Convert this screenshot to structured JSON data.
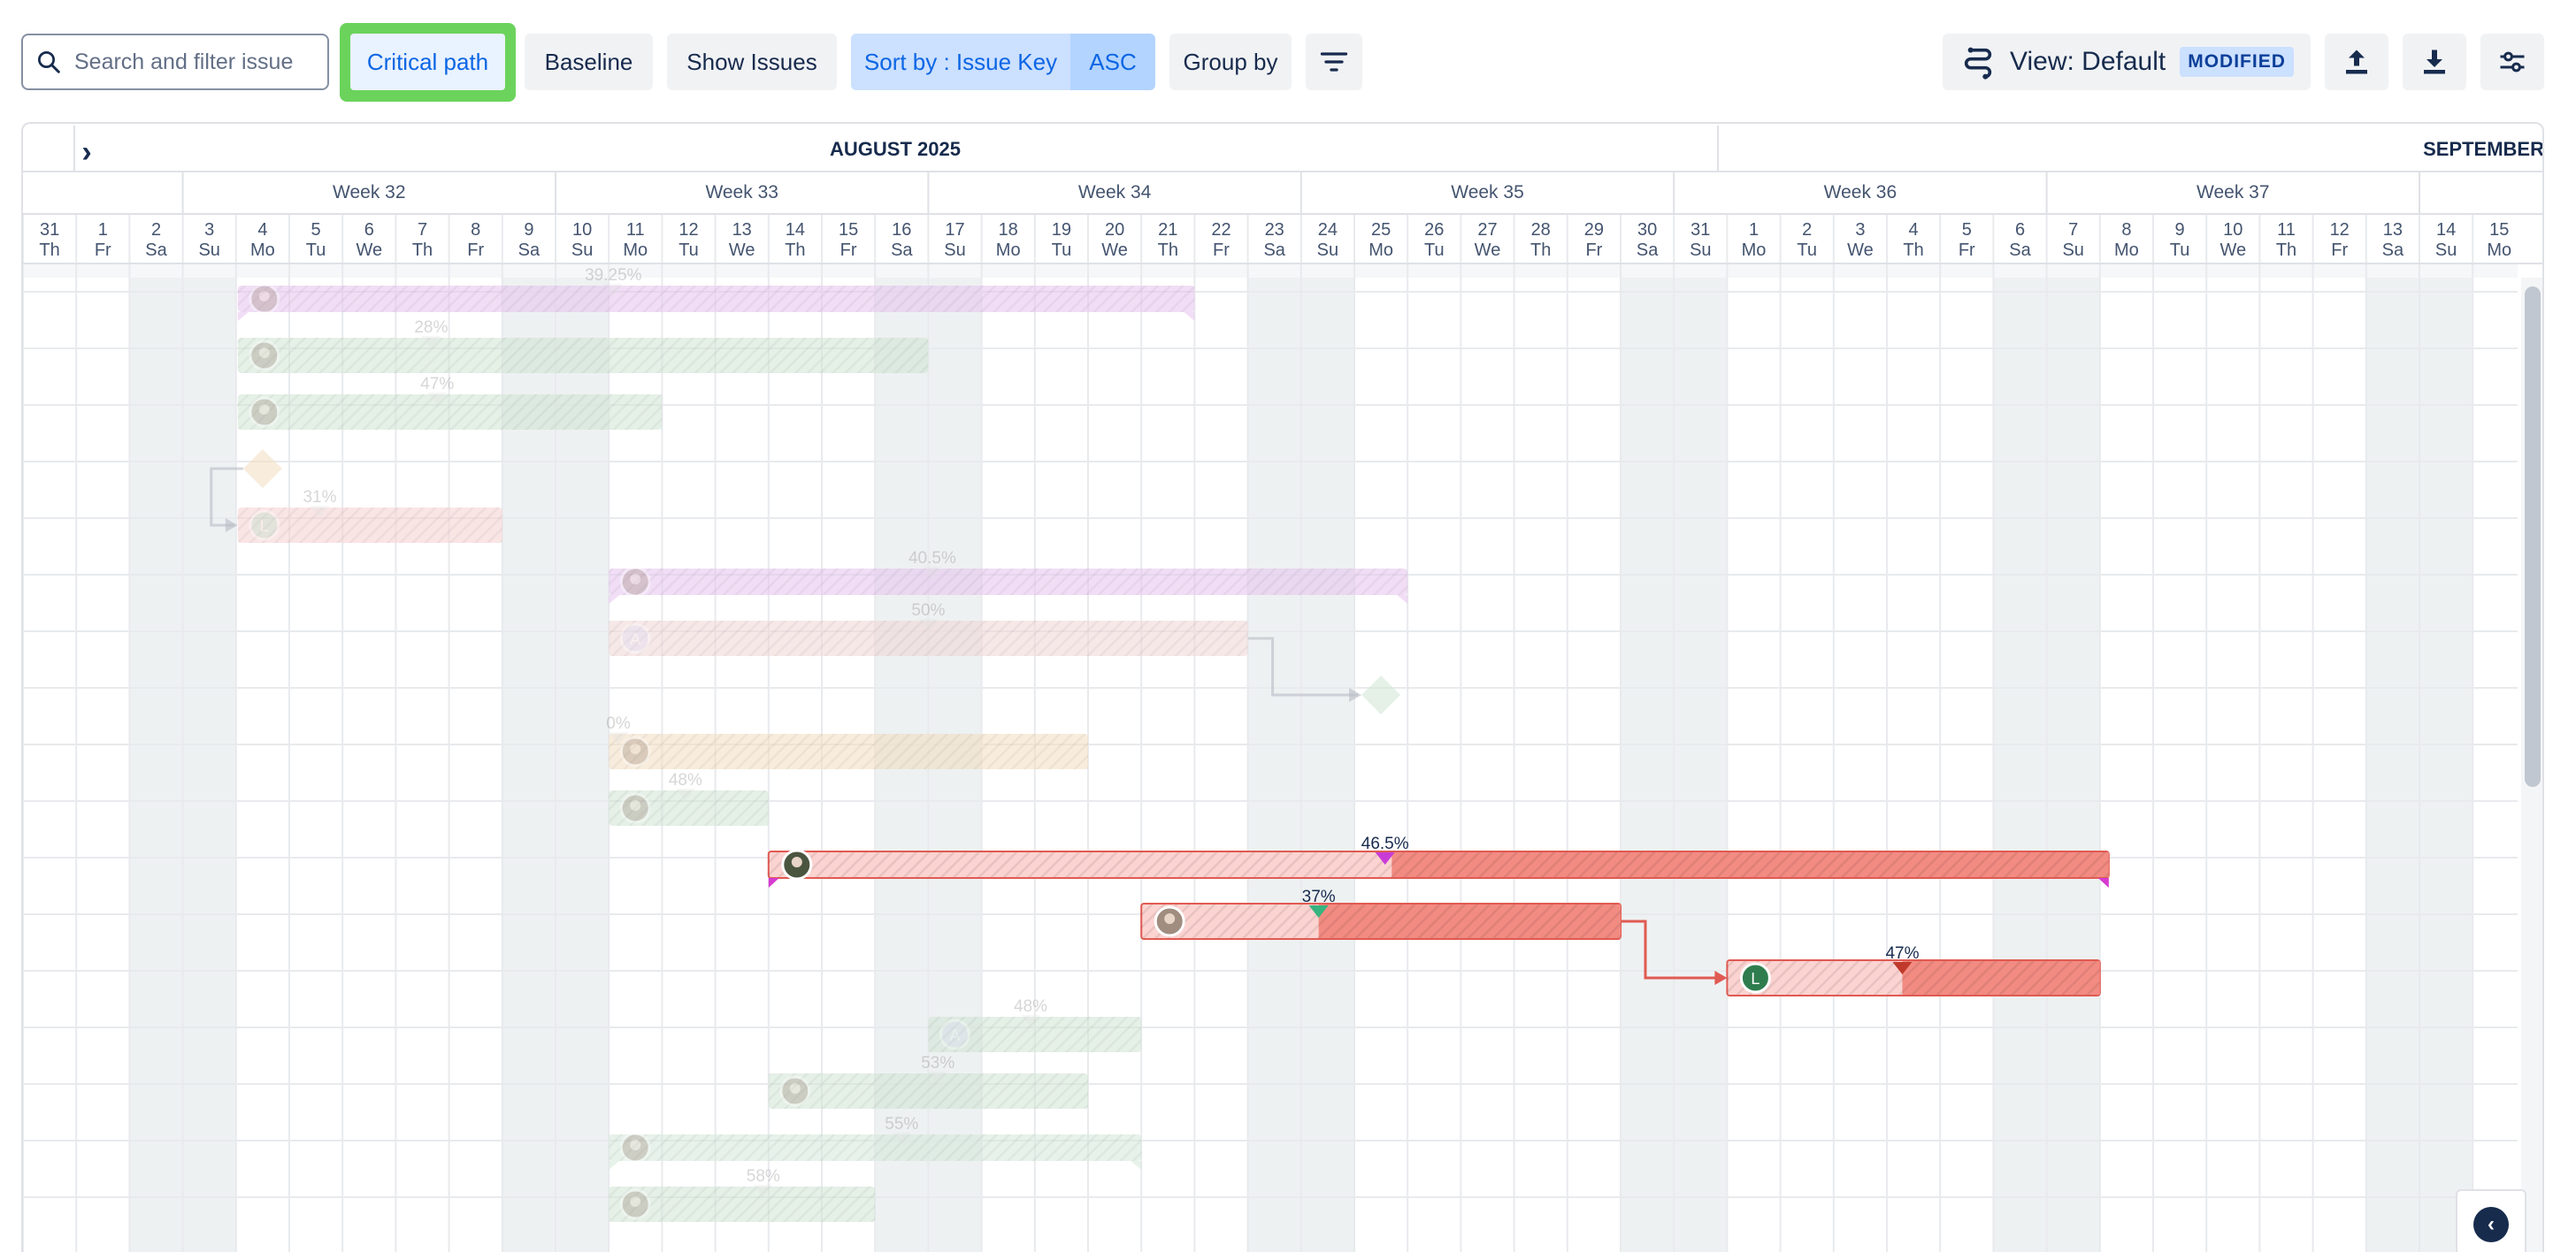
{
  "toolbar": {
    "search_placeholder": "Search and filter issue",
    "critical_path": "Critical path",
    "baseline": "Baseline",
    "show_issues": "Show Issues",
    "sort_label": "Sort by : Issue Key",
    "sort_dir": "ASC",
    "group_by": "Group by",
    "view_label": "View: Default",
    "view_badge": "MODIFIED"
  },
  "timeline": {
    "months": [
      {
        "label": "AUGUST 2025"
      },
      {
        "label": "SEPTEMBER"
      }
    ],
    "weeks": [
      "Week 32",
      "Week 33",
      "Week 34",
      "Week 35",
      "Week 36",
      "Week 37"
    ],
    "days": [
      {
        "num": "31",
        "dow": "Th"
      },
      {
        "num": "1",
        "dow": "Fr"
      },
      {
        "num": "2",
        "dow": "Sa"
      },
      {
        "num": "3",
        "dow": "Su"
      },
      {
        "num": "4",
        "dow": "Mo"
      },
      {
        "num": "5",
        "dow": "Tu"
      },
      {
        "num": "6",
        "dow": "We"
      },
      {
        "num": "7",
        "dow": "Th"
      },
      {
        "num": "8",
        "dow": "Fr"
      },
      {
        "num": "9",
        "dow": "Sa"
      },
      {
        "num": "10",
        "dow": "Su"
      },
      {
        "num": "11",
        "dow": "Mo"
      },
      {
        "num": "12",
        "dow": "Tu"
      },
      {
        "num": "13",
        "dow": "We"
      },
      {
        "num": "14",
        "dow": "Th"
      },
      {
        "num": "15",
        "dow": "Fr"
      },
      {
        "num": "16",
        "dow": "Sa"
      },
      {
        "num": "17",
        "dow": "Su"
      },
      {
        "num": "18",
        "dow": "Mo"
      },
      {
        "num": "19",
        "dow": "Tu"
      },
      {
        "num": "20",
        "dow": "We"
      },
      {
        "num": "21",
        "dow": "Th"
      },
      {
        "num": "22",
        "dow": "Fr"
      },
      {
        "num": "23",
        "dow": "Sa"
      },
      {
        "num": "24",
        "dow": "Su"
      },
      {
        "num": "25",
        "dow": "Mo"
      },
      {
        "num": "26",
        "dow": "Tu"
      },
      {
        "num": "27",
        "dow": "We"
      },
      {
        "num": "28",
        "dow": "Th"
      },
      {
        "num": "29",
        "dow": "Fr"
      },
      {
        "num": "30",
        "dow": "Sa"
      },
      {
        "num": "31",
        "dow": "Su"
      },
      {
        "num": "1",
        "dow": "Mo"
      },
      {
        "num": "2",
        "dow": "Tu"
      },
      {
        "num": "3",
        "dow": "We"
      },
      {
        "num": "4",
        "dow": "Th"
      },
      {
        "num": "5",
        "dow": "Fr"
      },
      {
        "num": "6",
        "dow": "Sa"
      },
      {
        "num": "7",
        "dow": "Su"
      },
      {
        "num": "8",
        "dow": "Mo"
      },
      {
        "num": "9",
        "dow": "Tu"
      },
      {
        "num": "10",
        "dow": "We"
      },
      {
        "num": "11",
        "dow": "Th"
      },
      {
        "num": "12",
        "dow": "Fr"
      },
      {
        "num": "13",
        "dow": "Sa"
      },
      {
        "num": "14",
        "dow": "Su"
      },
      {
        "num": "15",
        "dow": "Mo"
      }
    ]
  },
  "tasks": [
    {
      "kind": "group",
      "start": 4,
      "end": 22,
      "progress": "39.25%",
      "color": "#e6c3ee",
      "avatar": "photo",
      "dimmed": true
    },
    {
      "kind": "task",
      "start": 4,
      "end": 17,
      "progress": "28%",
      "color": "#cfe3d4",
      "avatar": "photo",
      "dimmed": true
    },
    {
      "kind": "task",
      "start": 4,
      "end": 12,
      "progress": "47%",
      "color": "#cfe3d4",
      "avatar": "photo",
      "dimmed": true
    },
    {
      "kind": "milestone",
      "start": 4,
      "color": "#f3dcc0",
      "dimmed": true
    },
    {
      "kind": "task",
      "start": 4,
      "end": 9,
      "progress": "31%",
      "color": "#f6cfcf",
      "avatar": "L",
      "avatar_color": "#b7e0c7",
      "dimmed": true
    },
    {
      "kind": "group",
      "start": 11,
      "end": 26,
      "progress": "40.5%",
      "color": "#e6c3ee",
      "avatar": "photo",
      "dimmed": true
    },
    {
      "kind": "task",
      "start": 11,
      "end": 23,
      "progress": "50%",
      "color": "#f1d6d6",
      "avatar": "A",
      "avatar_color": "#dcdcf6",
      "dimmed": true
    },
    {
      "kind": "milestone",
      "start": 25,
      "color": "#cfe6d4",
      "dimmed": true
    },
    {
      "kind": "task",
      "start": 11,
      "end": 20,
      "progress": "0%",
      "color": "#f3dcc0",
      "avatar": "photo",
      "dimmed": true
    },
    {
      "kind": "task",
      "start": 11,
      "end": 14,
      "progress": "48%",
      "color": "#cfe3d4",
      "avatar": "photo",
      "dimmed": true
    },
    {
      "kind": "critical-group",
      "start": 14,
      "end": 39,
      "progress": "46.5%",
      "avatar": "photo-dark",
      "dimmed": false
    },
    {
      "kind": "critical",
      "start": 21,
      "end": 30,
      "progress": "37%",
      "fill": 0.37,
      "avatar": "photo",
      "dimmed": false
    },
    {
      "kind": "critical",
      "start": 32,
      "end": 39,
      "progress": "47%",
      "fill": 0.47,
      "avatar": "L",
      "avatar_color": "#2f7d4e",
      "dimmed": false
    },
    {
      "kind": "task",
      "start": 17,
      "end": 21,
      "progress": "48%",
      "color": "#cfe3d4",
      "avatar": "A",
      "avatar_color": "#dcdcf6",
      "dimmed": true
    },
    {
      "kind": "task",
      "start": 14,
      "end": 20,
      "progress": "53%",
      "color": "#cfe3d4",
      "avatar": "photo",
      "dimmed": true
    },
    {
      "kind": "group",
      "start": 11,
      "end": 21,
      "progress": "55%",
      "color": "#d3e7d8",
      "avatar": "photo",
      "dimmed": true
    },
    {
      "kind": "task",
      "start": 11,
      "end": 16,
      "progress": "58%",
      "color": "#cfe3d4",
      "avatar": "photo",
      "dimmed": true
    }
  ],
  "dependencies": [
    {
      "from": 3,
      "to": 4
    },
    {
      "from": 6,
      "to": 7
    },
    {
      "from": 11,
      "to": 12,
      "critical": true
    },
    {
      "from": 16,
      "to": 17
    }
  ],
  "colors": {
    "accent": "#0c66e4",
    "critical": "#f28b82",
    "critical_border": "#e05a52",
    "weekend": "#eef1f2",
    "grid": "#e8eaed",
    "critical_highlight": "#6bd35c"
  },
  "icons": {
    "search": "search-icon",
    "filter": "filter-icon",
    "view": "view-icon",
    "export": "upload-icon",
    "import": "download-icon",
    "settings": "sliders-icon",
    "collapse": "chevron-left-icon",
    "expand": "chevron-right-icon"
  }
}
